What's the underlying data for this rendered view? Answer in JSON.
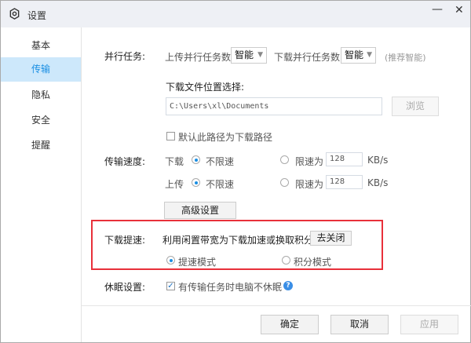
{
  "window": {
    "title": "设置",
    "icon": "gear-icon",
    "minimize": "—",
    "close": "✕"
  },
  "sidebar": {
    "items": [
      {
        "label": "基本"
      },
      {
        "label": "传输",
        "active": true
      },
      {
        "label": "隐私"
      },
      {
        "label": "安全"
      },
      {
        "label": "提醒"
      }
    ]
  },
  "parallel": {
    "label": "并行任务:",
    "upload_label": "上传并行任务数",
    "upload_value": "智能",
    "download_label": "下载并行任务数",
    "download_value": "智能",
    "hint": "(推荐智能)"
  },
  "location": {
    "label": "下载文件位置选择:",
    "path": "C:\\Users\\xl\\Documents",
    "browse": "浏览",
    "default_checkbox": "默认此路径为下载路径",
    "default_checked": false
  },
  "speed": {
    "label": "传输速度:",
    "download_label": "下载",
    "upload_label": "上传",
    "unlimited": "不限速",
    "limit_label": "限速为",
    "download_limit": "128",
    "upload_limit": "128",
    "unit": "KB/s",
    "advanced": "高级设置"
  },
  "boost": {
    "label": "下载提速:",
    "desc": "利用闲置带宽为下载加速或换取积分",
    "close_button": "去关闭",
    "mode_speed": "提速模式",
    "mode_points": "积分模式",
    "selected": "提速模式",
    "highlight_color": "#e8303a"
  },
  "sleep": {
    "label": "休眠设置:",
    "checkbox": "有传输任务时电脑不休眠",
    "checked": true
  },
  "footer": {
    "ok": "确定",
    "cancel": "取消",
    "apply": "应用"
  },
  "colors": {
    "accent": "#1a8fe3",
    "active_bg": "#cde8fb"
  }
}
